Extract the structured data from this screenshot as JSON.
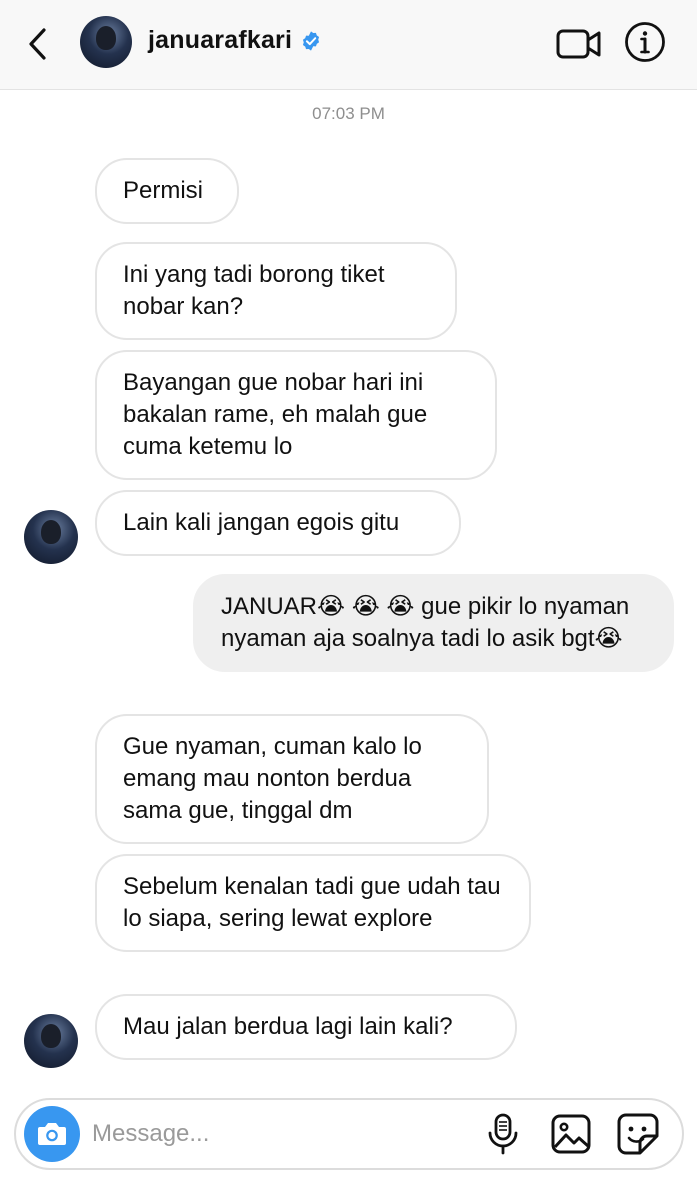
{
  "header": {
    "username": "januarafkari",
    "verified": true,
    "icons": [
      "back-chevron-icon",
      "verified-badge-icon",
      "video-call-icon",
      "info-icon"
    ],
    "accent_color": "#3897f0"
  },
  "timestamp": "07:03 PM",
  "messages": [
    {
      "sender": "other",
      "text": "Permisi"
    },
    {
      "sender": "other",
      "text": "Ini yang tadi borong tiket nobar kan?"
    },
    {
      "sender": "other",
      "text": "Bayangan gue nobar hari ini bakalan rame, eh malah gue cuma ketemu lo"
    },
    {
      "sender": "other",
      "text": "Lain kali jangan egois gitu"
    },
    {
      "sender": "me",
      "text": "JANUAR😭 😭 😭  gue pikir lo nyaman nyaman aja soalnya tadi lo asik bgt😭"
    },
    {
      "sender": "other",
      "text": "Gue nyaman, cuman kalo lo emang mau nonton berdua sama gue, tinggal dm"
    },
    {
      "sender": "other",
      "text": "Sebelum kenalan tadi gue udah tau lo siapa, sering lewat explore"
    },
    {
      "sender": "other",
      "text": "Mau jalan berdua lagi lain kali?"
    }
  ],
  "composer": {
    "placeholder": "Message...",
    "icons": [
      "camera-icon",
      "microphone-icon",
      "gallery-icon",
      "sticker-icon"
    ]
  }
}
